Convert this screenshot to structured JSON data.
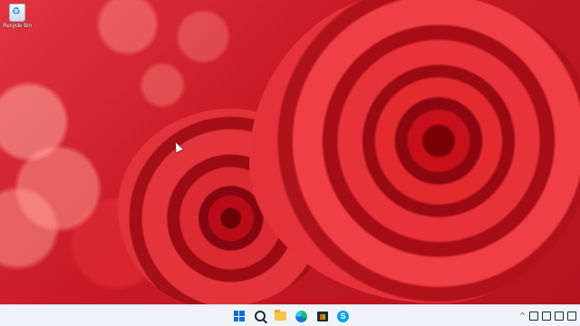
{
  "desktop": {
    "icons": [
      {
        "label": "Recycle Bin",
        "icon": "recycle-bin-icon"
      }
    ]
  },
  "taskbar": {
    "pinned": [
      {
        "name": "start",
        "icon": "windows-logo-icon"
      },
      {
        "name": "search",
        "icon": "search-icon"
      },
      {
        "name": "file-explorer",
        "icon": "folder-icon"
      },
      {
        "name": "edge",
        "icon": "edge-browser-icon"
      },
      {
        "name": "store",
        "icon": "store-icon"
      },
      {
        "name": "skype",
        "icon": "skype-icon",
        "glyph": "S"
      }
    ],
    "tray": {
      "chevron": "^",
      "icons": [
        "network-icon",
        "meet-now-icon",
        "volume-icon",
        "battery-icon"
      ]
    }
  }
}
